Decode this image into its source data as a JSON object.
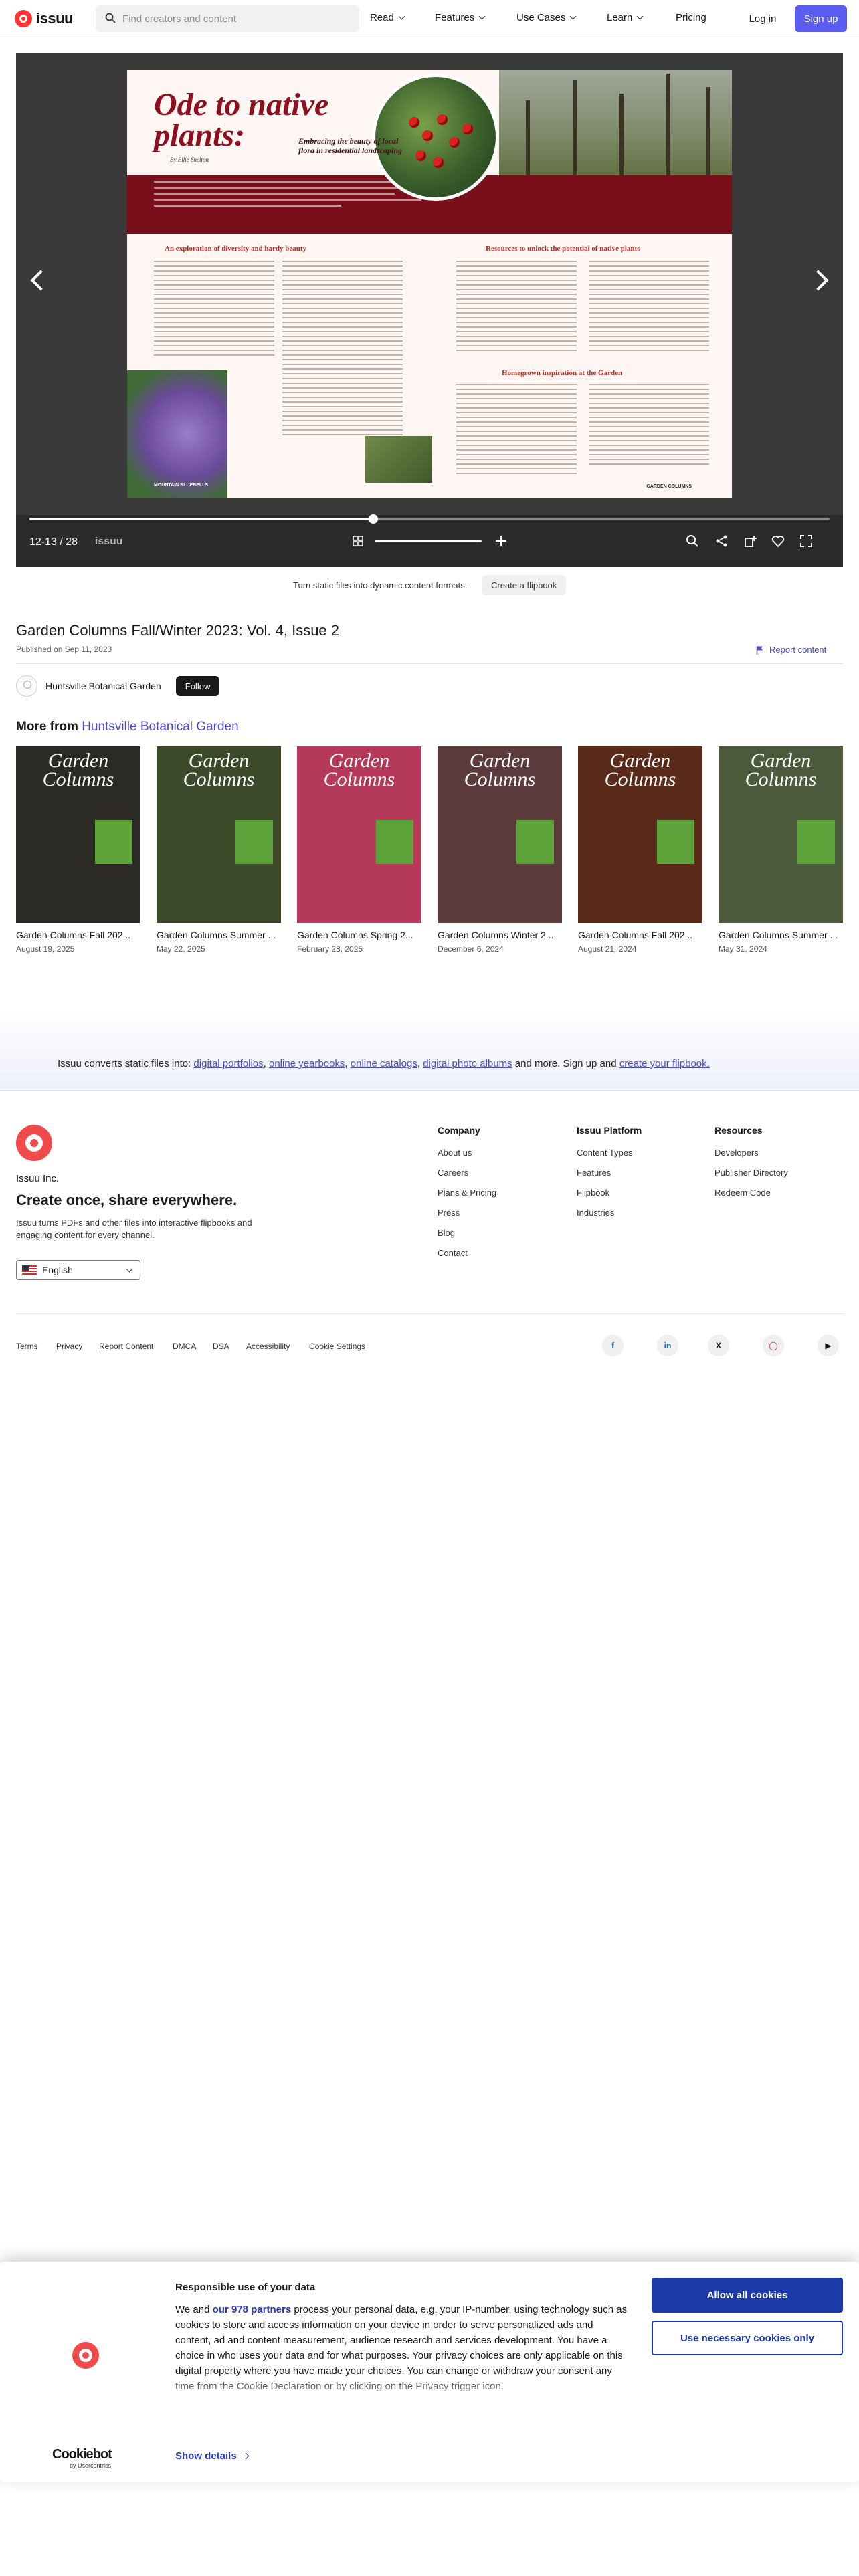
{
  "header": {
    "logo": "issuu",
    "search_placeholder": "Find creators and content",
    "nav": [
      "Read",
      "Features",
      "Use Cases",
      "Learn",
      "Pricing"
    ],
    "login": "Log in",
    "signup": "Sign up"
  },
  "reader": {
    "page_indicator": "12-13 / 28",
    "brand": "issuu",
    "progress": 0.43,
    "spread": {
      "title": "Ode to native plants:",
      "subtitle": "Embracing the beauty of local flora in residential landscaping",
      "byline": "By Ellie Shelton",
      "sections": [
        "An exploration of diversity and hardy beauty",
        "Resources to unlock the potential of native plants",
        "Homegrown inspiration at the Garden"
      ],
      "caption": "MOUNTAIN BLUEBELLS",
      "footer": "GARDEN COLUMNS"
    }
  },
  "promo": {
    "text": "Turn static files into dynamic content formats.",
    "button": "Create a flipbook"
  },
  "document": {
    "title": "Garden Columns Fall/Winter 2023: Vol. 4, Issue 2",
    "published": "Published on Sep 11, 2023",
    "report": "Report content"
  },
  "author": {
    "name": "Huntsville Botanical Garden",
    "follow": "Follow"
  },
  "more": {
    "prefix": "More from",
    "link": "Huntsville Botanical Garden",
    "items": [
      {
        "title": "Garden Columns Fall 202...",
        "date": "August 19, 2025",
        "cover_text": "Garden Columns",
        "bg": "#2c2a25"
      },
      {
        "title": "Garden Columns Summer ...",
        "date": "May 22, 2025",
        "cover_text": "Garden Columns",
        "bg": "#3d4a2a"
      },
      {
        "title": "Garden Columns Spring 2...",
        "date": "February 28, 2025",
        "cover_text": "Garden Columns",
        "bg": "#b53a5a"
      },
      {
        "title": "Garden Columns Winter 2...",
        "date": "December 6, 2024",
        "cover_text": "Garden Columns",
        "bg": "#5a3a3a"
      },
      {
        "title": "Garden Columns Fall 202...",
        "date": "August 21, 2024",
        "cover_text": "Garden Columns",
        "bg": "#5a2a1a"
      },
      {
        "title": "Garden Columns Summer ...",
        "date": "May 31, 2024",
        "cover_text": "Garden Columns",
        "bg": "#4a5a3a"
      }
    ]
  },
  "converts": {
    "lead": "Issuu converts static files into:",
    "links": [
      "digital portfolios",
      "online yearbooks",
      "online catalogs",
      "digital photo albums"
    ],
    "tail": "and more. Sign up and",
    "cta": "create your flipbook."
  },
  "footer": {
    "company_name": "Issuu Inc.",
    "tagline": "Create once, share everywhere.",
    "description": "Issuu turns PDFs and other files into interactive flipbooks and engaging content for every channel.",
    "language": "English",
    "columns": [
      {
        "heading": "Company",
        "links": [
          "About us",
          "Careers",
          "Plans & Pricing",
          "Press",
          "Blog",
          "Contact"
        ]
      },
      {
        "heading": "Issuu Platform",
        "links": [
          "Content Types",
          "Features",
          "Flipbook",
          "Industries"
        ]
      },
      {
        "heading": "Resources",
        "links": [
          "Developers",
          "Publisher Directory",
          "Redeem Code"
        ]
      }
    ],
    "legal": [
      "Terms",
      "Privacy",
      "Report Content",
      "DMCA",
      "DSA",
      "Accessibility",
      "Cookie Settings"
    ],
    "social": [
      "facebook-icon",
      "linkedin-icon",
      "x-icon",
      "instagram-icon",
      "youtube-icon"
    ]
  },
  "cookie": {
    "title": "Responsible use of your data",
    "body_pre": "We and",
    "partners": "our 978 partners",
    "body": "process your personal data, e.g. your IP-number, using technology such as cookies to store and access information on your device in order to serve personalized ads and content, ad and content measurement, audience research and services development. You have a choice in who uses your data and for what purposes. Your privacy choices are only applicable on this digital property where you have made your choices. You can change or withdraw your consent any time from the Cookie Declaration or by clicking on the Privacy trigger icon.",
    "allow": "Allow all cookies",
    "necessary": "Use necessary cookies only",
    "cookiebot": "Cookiebot",
    "cookiebot_sub": "by Usercentrics",
    "details": "Show details"
  }
}
